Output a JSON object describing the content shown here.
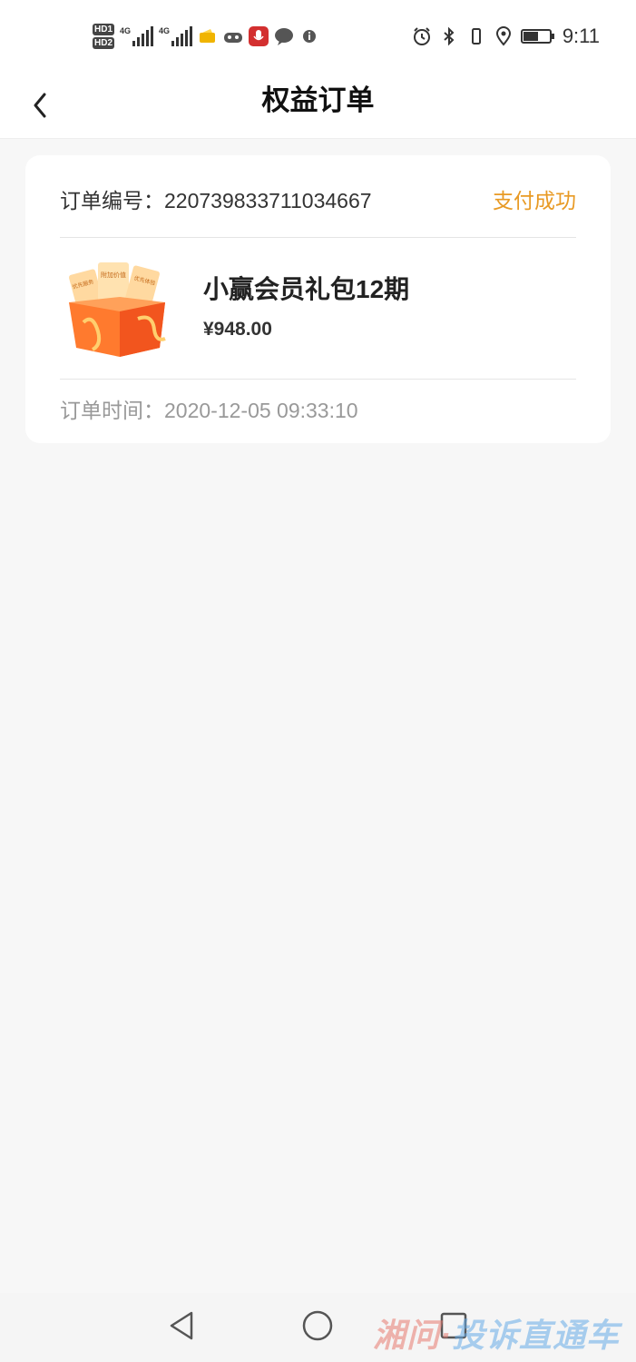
{
  "status_bar": {
    "hd1": "HD1",
    "hd2": "HD2",
    "sig1_label": "4G",
    "sig2_label": "4G",
    "time": "9:11"
  },
  "header": {
    "title": "权益订单"
  },
  "order": {
    "number_label": "订单编号：",
    "number": "220739833711034667",
    "status": "支付成功",
    "product_name": "小赢会员礼包12期",
    "price": "¥948.00",
    "time_label": "订单时间：",
    "time": "2020-12-05 09:33:10",
    "thumb_tag_1": "附加价值",
    "thumb_tag_2": "优先服务",
    "thumb_tag_3": "优先体验"
  },
  "watermark": {
    "part1": "湘问·",
    "part2": "投诉直通车"
  },
  "colors": {
    "status_accent": "#e89a24",
    "background": "#f7f7f7"
  }
}
